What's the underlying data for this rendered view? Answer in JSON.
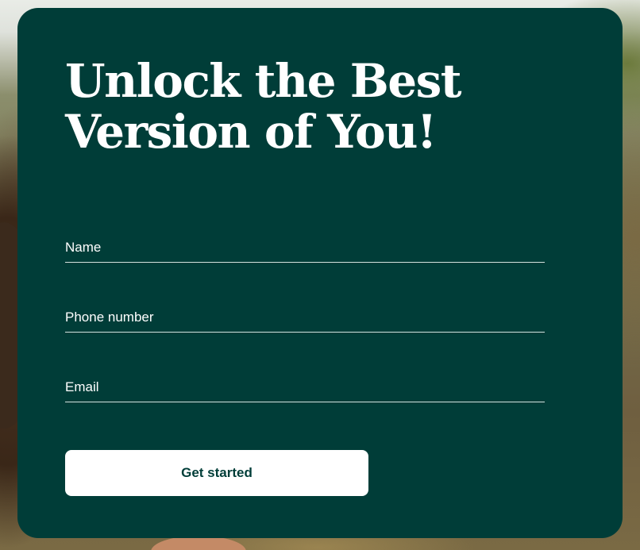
{
  "hero": {
    "title": "Unlock the Best Version of You!"
  },
  "form": {
    "name_label": "Name",
    "phone_label": "Phone number",
    "email_label": "Email",
    "submit_label": "Get started"
  },
  "colors": {
    "card_background": "#003d38",
    "text": "#ffffff",
    "button_background": "#ffffff",
    "button_text": "#003d38"
  }
}
